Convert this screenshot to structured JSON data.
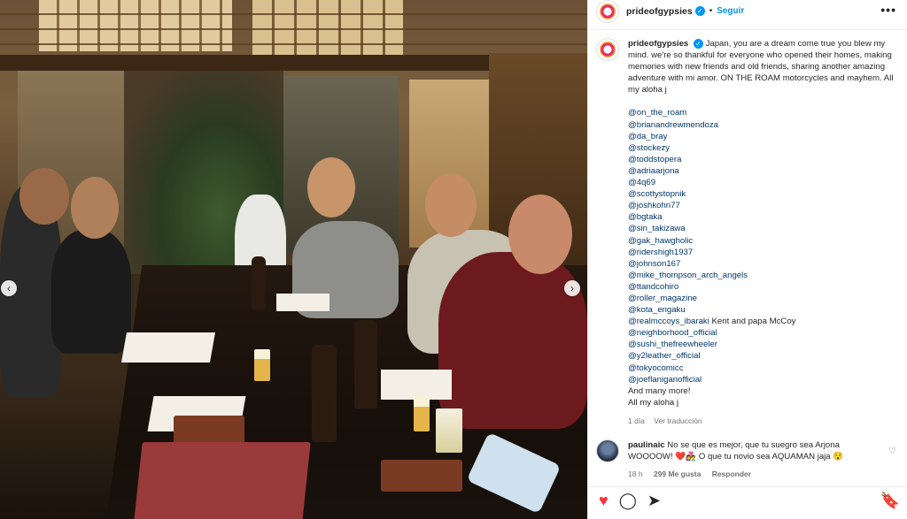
{
  "post": {
    "username": "prideofgypsies",
    "verified_badge": "✓",
    "separator": "•",
    "follow_label": "Seguir",
    "more_label": "•••"
  },
  "photo": {
    "prev_arrow": "‹",
    "next_arrow": "›"
  },
  "caption": {
    "username": "prideofgypsies",
    "text": "Japan, you are a dream come true you blew my mind. we're so thankful for everyone who opened their homes, making memories with new friends and old friends, sharing another amazing adventure with mi amor. ON THE ROAM motorcycles and mayhem. All my aloha j",
    "tags": [
      "@on_the_roam",
      "@brianandrewmendoza",
      "@da_bray",
      "@stockezy",
      "@toddstopera",
      "@adriaarjona",
      "@4q69",
      "@scottystopnik",
      "@joshkohn77",
      "@bgtaka",
      "@sin_takizawa",
      "@gak_hawgholic",
      "@ridershigh1937",
      "@johnson167",
      "@mike_thompson_arch_angels",
      "@ttandcohiro",
      "@roller_magazine",
      "@kota_engaku"
    ],
    "mccoy_tag": "@realmccoys_ibaraki",
    "mccoy_text": " Kent and papa McCoy",
    "tags_after": [
      "@neighborhood_official",
      "@sushi_thefreewheeler",
      "@y2leather_official",
      "@tokyocomicc",
      "@joeflaniganofficial"
    ],
    "closing_1": "And many more!",
    "closing_2": "All my aloha j",
    "age": "1 día",
    "translate_label": "Ver traducción"
  },
  "comment": {
    "username": "paulinaic",
    "text": " No se que es mejor, que tu suegro sea Arjona WOOOOW! ❤️👩‍❤️‍👨 O que tu novio sea AQUAMAN jaja 😯",
    "age": "18 h",
    "likes": "299 Me gusta",
    "reply_label": "Responder",
    "like_icon": "♡"
  },
  "actions": {
    "like_icon": "♥",
    "comment_icon": "◯",
    "share_icon": "➤",
    "save_icon": "🔖"
  }
}
